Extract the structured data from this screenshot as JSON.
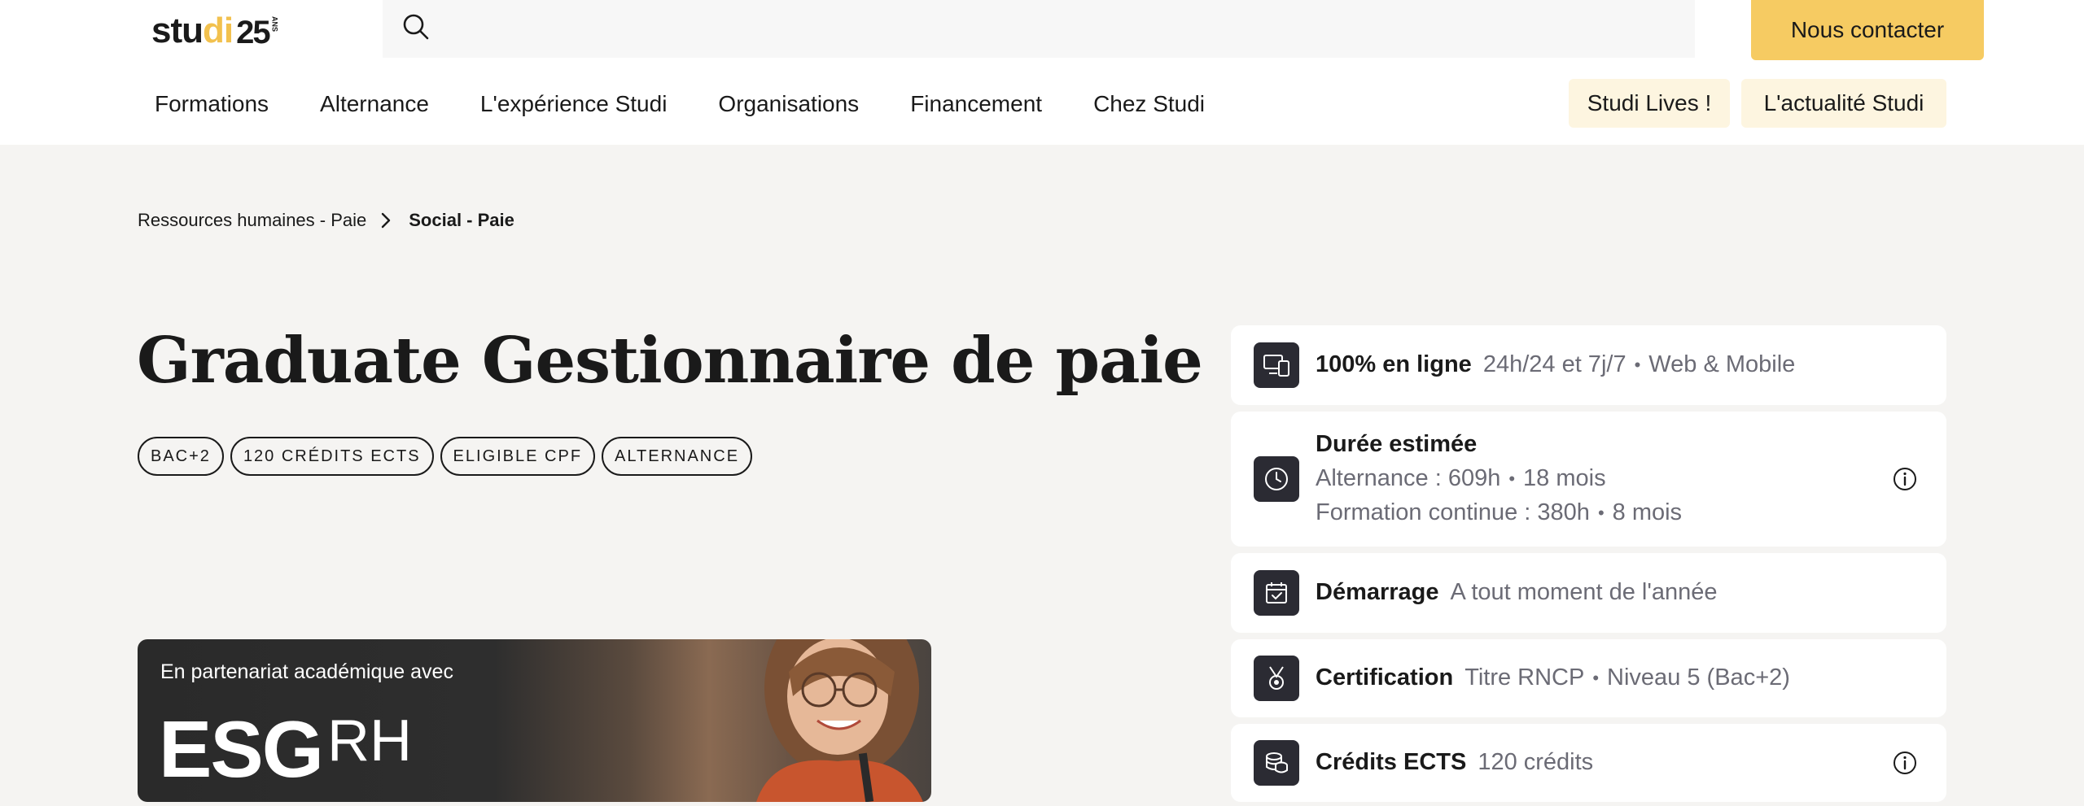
{
  "header": {
    "logo_text_pre": "stu",
    "logo_text_accent": "di",
    "logo_number": "25",
    "logo_ans": "ANS",
    "search_placeholder": "",
    "contact_label": "Nous contacter"
  },
  "nav": {
    "items": [
      "Formations",
      "Alternance",
      "L'expérience Studi",
      "Organisations",
      "Financement",
      "Chez Studi"
    ],
    "pill_lives": "Studi Lives !",
    "pill_news": "L'actualité Studi"
  },
  "breadcrumb": {
    "parent": "Ressources humaines - Paie",
    "current": "Social - Paie"
  },
  "course": {
    "title": "Graduate Gestionnaire de paie",
    "tags": [
      "BAC+2",
      "120 CRÉDITS ECTS",
      "ELIGIBLE CPF",
      "ALTERNANCE"
    ]
  },
  "partner": {
    "text": "En partenariat académique avec",
    "logo_main": "ESG",
    "logo_sub": "RH"
  },
  "info": {
    "online": {
      "strong": "100% en ligne",
      "a": "24h/24 et 7j/7",
      "b": "Web & Mobile"
    },
    "duration": {
      "strong": "Durée estimée",
      "l1a": "Alternance : 609h",
      "l1b": "18 mois",
      "l2a": "Formation continue : 380h",
      "l2b": "8 mois"
    },
    "start": {
      "strong": "Démarrage",
      "a": "A tout moment de l'année"
    },
    "cert": {
      "strong": "Certification",
      "a": "Titre RNCP",
      "b": "Niveau 5 (Bac+2)"
    },
    "ects": {
      "strong": "Crédits ECTS",
      "a": "120 crédits"
    },
    "separator": "•"
  }
}
